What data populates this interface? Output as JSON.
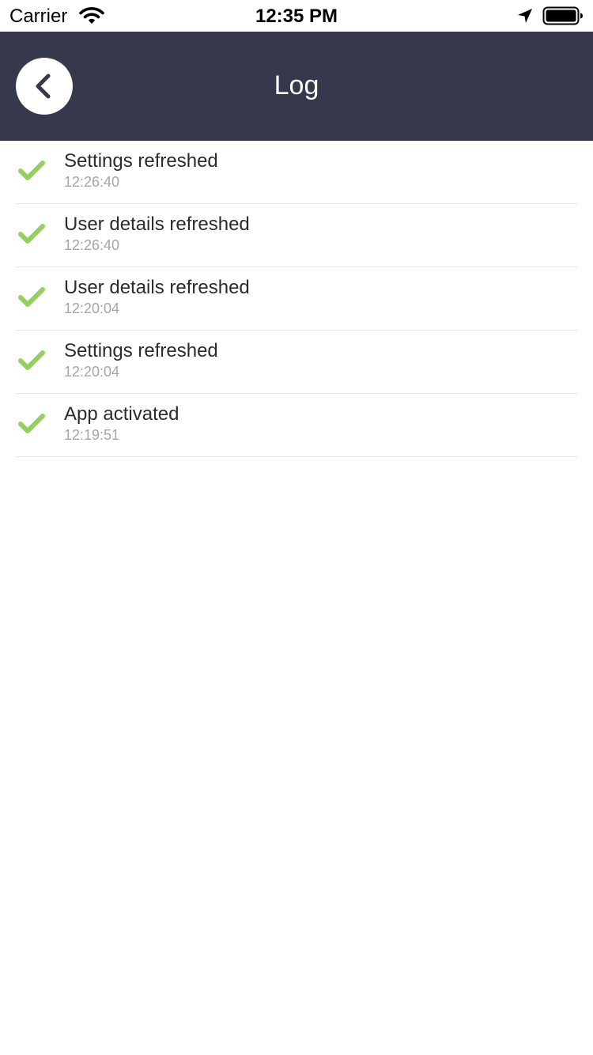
{
  "status_bar": {
    "carrier": "Carrier",
    "time": "12:35 PM",
    "icons": [
      "wifi-icon",
      "location-arrow-icon",
      "battery-icon"
    ]
  },
  "nav": {
    "title": "Log",
    "back_icon": "chevron-left-icon",
    "background_color": "#36384b"
  },
  "log": {
    "status_icon": "checkmark-icon",
    "status_color": "#94cf5f",
    "items": [
      {
        "message": "Settings refreshed",
        "time": "12:26:40"
      },
      {
        "message": "User details refreshed",
        "time": "12:26:40"
      },
      {
        "message": "User details refreshed",
        "time": "12:20:04"
      },
      {
        "message": "Settings refreshed",
        "time": "12:20:04"
      },
      {
        "message": "App activated",
        "time": "12:19:51"
      }
    ]
  }
}
